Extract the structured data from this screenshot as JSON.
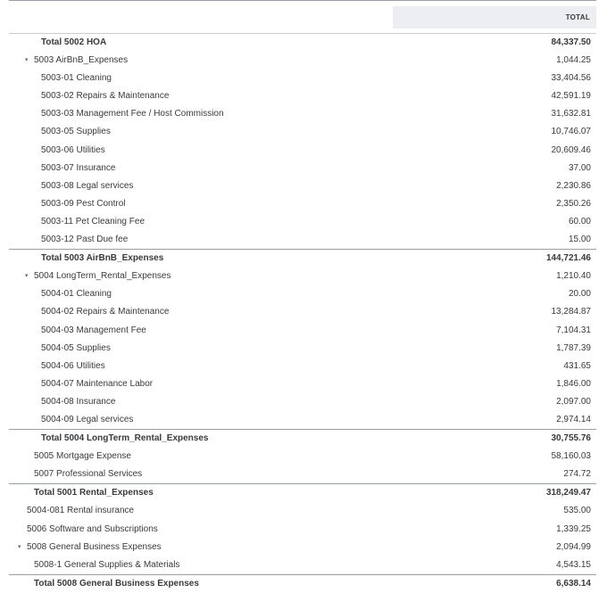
{
  "header": {
    "total_label": "TOTAL"
  },
  "rows": [
    {
      "label": "Total 5002 HOA",
      "value": "84,337.50",
      "level": 2,
      "total": true,
      "sep": false,
      "caret": false
    },
    {
      "label": "5003 AirBnB_Expenses",
      "value": "1,044.25",
      "level": 1,
      "total": false,
      "sep": false,
      "caret": true
    },
    {
      "label": "5003-01 Cleaning",
      "value": "33,404.56",
      "level": 2,
      "total": false,
      "sep": false,
      "caret": false
    },
    {
      "label": "5003-02 Repairs & Maintenance",
      "value": "42,591.19",
      "level": 2,
      "total": false,
      "sep": false,
      "caret": false
    },
    {
      "label": "5003-03 Management Fee / Host Commission",
      "value": "31,632.81",
      "level": 2,
      "total": false,
      "sep": false,
      "caret": false
    },
    {
      "label": "5003-05 Supplies",
      "value": "10,746.07",
      "level": 2,
      "total": false,
      "sep": false,
      "caret": false
    },
    {
      "label": "5003-06 Utilities",
      "value": "20,609.46",
      "level": 2,
      "total": false,
      "sep": false,
      "caret": false
    },
    {
      "label": "5003-07 Insurance",
      "value": "37.00",
      "level": 2,
      "total": false,
      "sep": false,
      "caret": false
    },
    {
      "label": "5003-08 Legal services",
      "value": "2,230.86",
      "level": 2,
      "total": false,
      "sep": false,
      "caret": false
    },
    {
      "label": "5003-09 Pest Control",
      "value": "2,350.26",
      "level": 2,
      "total": false,
      "sep": false,
      "caret": false
    },
    {
      "label": "5003-11 Pet Cleaning Fee",
      "value": "60.00",
      "level": 2,
      "total": false,
      "sep": false,
      "caret": false
    },
    {
      "label": "5003-12 Past Due fee",
      "value": "15.00",
      "level": 2,
      "total": false,
      "sep": false,
      "caret": false
    },
    {
      "label": "Total 5003 AirBnB_Expenses",
      "value": "144,721.46",
      "level": 2,
      "total": true,
      "sep": true,
      "caret": false
    },
    {
      "label": "5004 LongTerm_Rental_Expenses",
      "value": "1,210.40",
      "level": 1,
      "total": false,
      "sep": false,
      "caret": true
    },
    {
      "label": "5004-01 Cleaning",
      "value": "20.00",
      "level": 2,
      "total": false,
      "sep": false,
      "caret": false
    },
    {
      "label": "5004-02 Repairs & Maintenance",
      "value": "13,284.87",
      "level": 2,
      "total": false,
      "sep": false,
      "caret": false
    },
    {
      "label": "5004-03 Management Fee",
      "value": "7,104.31",
      "level": 2,
      "total": false,
      "sep": false,
      "caret": false
    },
    {
      "label": "5004-05 Supplies",
      "value": "1,787.39",
      "level": 2,
      "total": false,
      "sep": false,
      "caret": false
    },
    {
      "label": "5004-06 Utilities",
      "value": "431.65",
      "level": 2,
      "total": false,
      "sep": false,
      "caret": false
    },
    {
      "label": "5004-07 Maintenance Labor",
      "value": "1,846.00",
      "level": 2,
      "total": false,
      "sep": false,
      "caret": false
    },
    {
      "label": "5004-08 Insurance",
      "value": "2,097.00",
      "level": 2,
      "total": false,
      "sep": false,
      "caret": false
    },
    {
      "label": "5004-09 Legal services",
      "value": "2,974.14",
      "level": 2,
      "total": false,
      "sep": false,
      "caret": false
    },
    {
      "label": "Total 5004 LongTerm_Rental_Expenses",
      "value": "30,755.76",
      "level": 2,
      "total": true,
      "sep": true,
      "caret": false
    },
    {
      "label": "5005 Mortgage Expense",
      "value": "58,160.03",
      "level": 1,
      "total": false,
      "sep": false,
      "caret": false
    },
    {
      "label": "5007 Professional Services",
      "value": "274.72",
      "level": 1,
      "total": false,
      "sep": false,
      "caret": false
    },
    {
      "label": "Total 5001 Rental_Expenses",
      "value": "318,249.47",
      "level": 1,
      "total": true,
      "sep": true,
      "caret": false
    },
    {
      "label": "5004-081 Rental insurance",
      "value": "535.00",
      "level": 0,
      "total": false,
      "sep": false,
      "caret": false
    },
    {
      "label": "5006 Software and Subscriptions",
      "value": "1,339.25",
      "level": 0,
      "total": false,
      "sep": false,
      "caret": false
    },
    {
      "label": "5008 General Business Expenses",
      "value": "2,094.99",
      "level": 0,
      "total": false,
      "sep": false,
      "caret": true
    },
    {
      "label": "5008-1 General Supplies & Materials",
      "value": "4,543.15",
      "level": 1,
      "total": false,
      "sep": false,
      "caret": false
    },
    {
      "label": "Total 5008 General Business Expenses",
      "value": "6,638.14",
      "level": 1,
      "total": true,
      "sep": true,
      "caret": false
    }
  ]
}
